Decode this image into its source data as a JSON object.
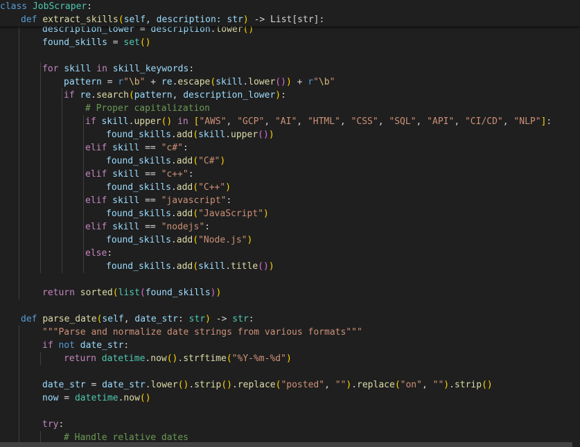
{
  "sticky": {
    "class_keyword": "class",
    "class_name": "JobScraper",
    "class_colon": ":",
    "def_keyword": "def",
    "method_name": "extract_skills",
    "params": "self, description: str",
    "return_annotation": "-> List[str]:"
  },
  "lines": [
    [
      [
        "var",
        "description_lower"
      ],
      [
        "op",
        " = "
      ],
      [
        "var",
        "description"
      ],
      [
        "op",
        "."
      ],
      [
        "fn",
        "lower"
      ],
      [
        "b1",
        "()"
      ]
    ],
    [
      [
        "var",
        "found_skills"
      ],
      [
        "op",
        " = "
      ],
      [
        "cls",
        "set"
      ],
      [
        "b1",
        "()"
      ]
    ],
    [],
    [
      [
        "ctrl",
        "for"
      ],
      [
        "op",
        " "
      ],
      [
        "var",
        "skill"
      ],
      [
        "op",
        " "
      ],
      [
        "ctrl",
        "in"
      ],
      [
        "op",
        " "
      ],
      [
        "var",
        "skill_keywords"
      ],
      [
        "op",
        ":"
      ]
    ],
    [
      [
        "var",
        "pattern"
      ],
      [
        "op",
        " = "
      ],
      [
        "kw",
        "r"
      ],
      [
        "str",
        "\""
      ],
      [
        "esc",
        "\\b"
      ],
      [
        "str",
        "\""
      ],
      [
        "op",
        " + "
      ],
      [
        "var",
        "re"
      ],
      [
        "op",
        "."
      ],
      [
        "fn",
        "escape"
      ],
      [
        "b1",
        "("
      ],
      [
        "var",
        "skill"
      ],
      [
        "op",
        "."
      ],
      [
        "fn",
        "lower"
      ],
      [
        "b2",
        "()"
      ],
      [
        "b1",
        ")"
      ],
      [
        "op",
        " + "
      ],
      [
        "kw",
        "r"
      ],
      [
        "str",
        "\""
      ],
      [
        "esc",
        "\\b"
      ],
      [
        "str",
        "\""
      ]
    ],
    [
      [
        "ctrl",
        "if"
      ],
      [
        "op",
        " "
      ],
      [
        "var",
        "re"
      ],
      [
        "op",
        "."
      ],
      [
        "fn",
        "search"
      ],
      [
        "b1",
        "("
      ],
      [
        "var",
        "pattern"
      ],
      [
        "op",
        ", "
      ],
      [
        "var",
        "description_lower"
      ],
      [
        "b1",
        ")"
      ],
      [
        "op",
        ":"
      ]
    ],
    [
      [
        "cm",
        "# Proper capitalization"
      ]
    ],
    [
      [
        "ctrl",
        "if"
      ],
      [
        "op",
        " "
      ],
      [
        "var",
        "skill"
      ],
      [
        "op",
        "."
      ],
      [
        "fn",
        "upper"
      ],
      [
        "b1",
        "()"
      ],
      [
        "op",
        " "
      ],
      [
        "ctrl",
        "in"
      ],
      [
        "op",
        " "
      ],
      [
        "b1",
        "["
      ],
      [
        "str",
        "\"AWS\""
      ],
      [
        "op",
        ", "
      ],
      [
        "str",
        "\"GCP\""
      ],
      [
        "op",
        ", "
      ],
      [
        "str",
        "\"AI\""
      ],
      [
        "op",
        ", "
      ],
      [
        "str",
        "\"HTML\""
      ],
      [
        "op",
        ", "
      ],
      [
        "str",
        "\"CSS\""
      ],
      [
        "op",
        ", "
      ],
      [
        "str",
        "\"SQL\""
      ],
      [
        "op",
        ", "
      ],
      [
        "str",
        "\"API\""
      ],
      [
        "op",
        ", "
      ],
      [
        "str",
        "\"CI/CD\""
      ],
      [
        "op",
        ", "
      ],
      [
        "str",
        "\"NLP\""
      ],
      [
        "b1",
        "]"
      ],
      [
        "op",
        ":"
      ]
    ],
    [
      [
        "var",
        "found_skills"
      ],
      [
        "op",
        "."
      ],
      [
        "fn",
        "add"
      ],
      [
        "b1",
        "("
      ],
      [
        "var",
        "skill"
      ],
      [
        "op",
        "."
      ],
      [
        "fn",
        "upper"
      ],
      [
        "b2",
        "()"
      ],
      [
        "b1",
        ")"
      ]
    ],
    [
      [
        "ctrl",
        "elif"
      ],
      [
        "op",
        " "
      ],
      [
        "var",
        "skill"
      ],
      [
        "op",
        " == "
      ],
      [
        "str",
        "\"c#\""
      ],
      [
        "op",
        ":"
      ]
    ],
    [
      [
        "var",
        "found_skills"
      ],
      [
        "op",
        "."
      ],
      [
        "fn",
        "add"
      ],
      [
        "b1",
        "("
      ],
      [
        "str",
        "\"C#\""
      ],
      [
        "b1",
        ")"
      ]
    ],
    [
      [
        "ctrl",
        "elif"
      ],
      [
        "op",
        " "
      ],
      [
        "var",
        "skill"
      ],
      [
        "op",
        " == "
      ],
      [
        "str",
        "\"c++\""
      ],
      [
        "op",
        ":"
      ]
    ],
    [
      [
        "var",
        "found_skills"
      ],
      [
        "op",
        "."
      ],
      [
        "fn",
        "add"
      ],
      [
        "b1",
        "("
      ],
      [
        "str",
        "\"C++\""
      ],
      [
        "b1",
        ")"
      ]
    ],
    [
      [
        "ctrl",
        "elif"
      ],
      [
        "op",
        " "
      ],
      [
        "var",
        "skill"
      ],
      [
        "op",
        " == "
      ],
      [
        "str",
        "\"javascript\""
      ],
      [
        "op",
        ":"
      ]
    ],
    [
      [
        "var",
        "found_skills"
      ],
      [
        "op",
        "."
      ],
      [
        "fn",
        "add"
      ],
      [
        "b1",
        "("
      ],
      [
        "str",
        "\"JavaScript\""
      ],
      [
        "b1",
        ")"
      ]
    ],
    [
      [
        "ctrl",
        "elif"
      ],
      [
        "op",
        " "
      ],
      [
        "var",
        "skill"
      ],
      [
        "op",
        " == "
      ],
      [
        "str",
        "\"nodejs\""
      ],
      [
        "op",
        ":"
      ]
    ],
    [
      [
        "var",
        "found_skills"
      ],
      [
        "op",
        "."
      ],
      [
        "fn",
        "add"
      ],
      [
        "b1",
        "("
      ],
      [
        "str",
        "\"Node.js\""
      ],
      [
        "b1",
        ")"
      ]
    ],
    [
      [
        "ctrl",
        "else"
      ],
      [
        "op",
        ":"
      ]
    ],
    [
      [
        "var",
        "found_skills"
      ],
      [
        "op",
        "."
      ],
      [
        "fn",
        "add"
      ],
      [
        "b1",
        "("
      ],
      [
        "var",
        "skill"
      ],
      [
        "op",
        "."
      ],
      [
        "fn",
        "title"
      ],
      [
        "b2",
        "()"
      ],
      [
        "b1",
        ")"
      ]
    ],
    [],
    [
      [
        "ctrl",
        "return"
      ],
      [
        "op",
        " "
      ],
      [
        "fn",
        "sorted"
      ],
      [
        "b1",
        "("
      ],
      [
        "cls",
        "list"
      ],
      [
        "b2",
        "("
      ],
      [
        "var",
        "found_skills"
      ],
      [
        "b2",
        ")"
      ],
      [
        "b1",
        ")"
      ]
    ],
    [],
    [
      [
        "kw",
        "def"
      ],
      [
        "op",
        " "
      ],
      [
        "fn",
        "parse_date"
      ],
      [
        "b1",
        "("
      ],
      [
        "var",
        "self"
      ],
      [
        "op",
        ", "
      ],
      [
        "var",
        "date_str"
      ],
      [
        "op",
        ": "
      ],
      [
        "cls",
        "str"
      ],
      [
        "b1",
        ")"
      ],
      [
        "op",
        " -> "
      ],
      [
        "cls",
        "str"
      ],
      [
        "op",
        ":"
      ]
    ],
    [
      [
        "str",
        "\"\"\"Parse and normalize date strings from various formats\"\"\""
      ]
    ],
    [
      [
        "ctrl",
        "if"
      ],
      [
        "op",
        " "
      ],
      [
        "kw",
        "not"
      ],
      [
        "op",
        " "
      ],
      [
        "var",
        "date_str"
      ],
      [
        "op",
        ":"
      ]
    ],
    [
      [
        "ctrl",
        "return"
      ],
      [
        "op",
        " "
      ],
      [
        "cls",
        "datetime"
      ],
      [
        "op",
        "."
      ],
      [
        "fn",
        "now"
      ],
      [
        "b1",
        "()"
      ],
      [
        "op",
        "."
      ],
      [
        "fn",
        "strftime"
      ],
      [
        "b1",
        "("
      ],
      [
        "str",
        "\"%Y-%m-%d\""
      ],
      [
        "b1",
        ")"
      ]
    ],
    [],
    [
      [
        "var",
        "date_str"
      ],
      [
        "op",
        " = "
      ],
      [
        "var",
        "date_str"
      ],
      [
        "op",
        "."
      ],
      [
        "fn",
        "lower"
      ],
      [
        "b1",
        "()"
      ],
      [
        "op",
        "."
      ],
      [
        "fn",
        "strip"
      ],
      [
        "b1",
        "()"
      ],
      [
        "op",
        "."
      ],
      [
        "fn",
        "replace"
      ],
      [
        "b1",
        "("
      ],
      [
        "str",
        "\"posted\""
      ],
      [
        "op",
        ", "
      ],
      [
        "str",
        "\"\""
      ],
      [
        "b1",
        ")"
      ],
      [
        "op",
        "."
      ],
      [
        "fn",
        "replace"
      ],
      [
        "b1",
        "("
      ],
      [
        "str",
        "\"on\""
      ],
      [
        "op",
        ", "
      ],
      [
        "str",
        "\"\""
      ],
      [
        "b1",
        ")"
      ],
      [
        "op",
        "."
      ],
      [
        "fn",
        "strip"
      ],
      [
        "b1",
        "()"
      ]
    ],
    [
      [
        "var",
        "now"
      ],
      [
        "op",
        " = "
      ],
      [
        "cls",
        "datetime"
      ],
      [
        "op",
        "."
      ],
      [
        "fn",
        "now"
      ],
      [
        "b1",
        "()"
      ]
    ],
    [],
    [
      [
        "ctrl",
        "try"
      ],
      [
        "op",
        ":"
      ]
    ],
    [
      [
        "cm",
        "# Handle relative dates"
      ]
    ]
  ]
}
